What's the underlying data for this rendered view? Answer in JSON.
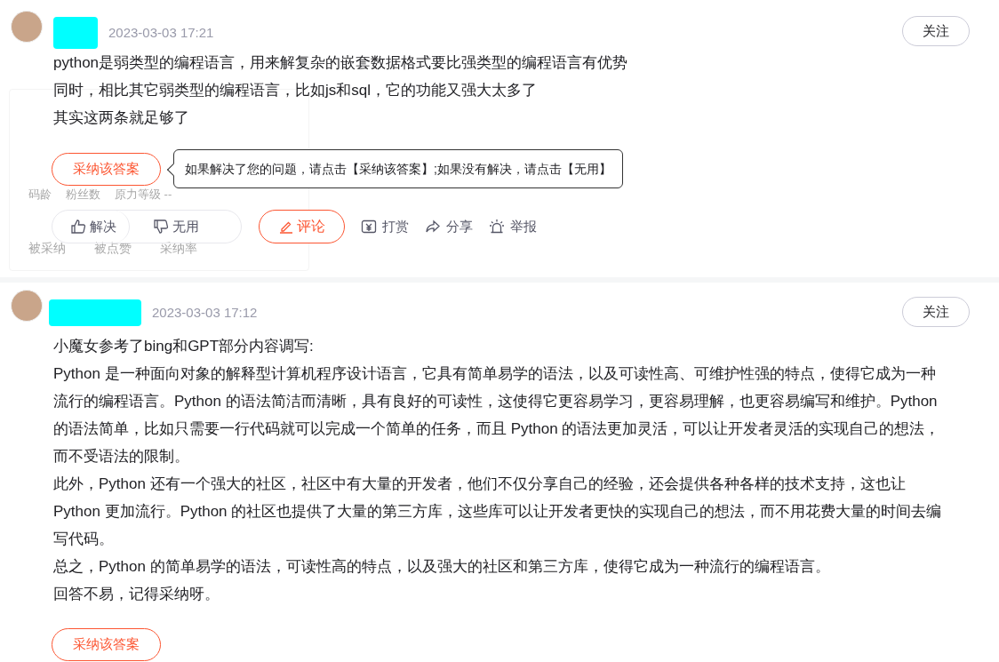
{
  "answers": [
    {
      "date": "2023-03-03 17:21",
      "follow": "关注",
      "paragraphs": [
        "python是弱类型的编程语言，用来解复杂的嵌套数据格式要比强类型的编程语言有优势",
        "同时，相比其它弱类型的编程语言，比如js和sql，它的功能又强大太多了",
        "其实这两条就足够了"
      ],
      "accept": "采纳该答案",
      "tooltip": "如果解决了您的问题，请点击【采纳该答案】;如果没有解决，请点击【无用】",
      "hover_card": {
        "row_1": [
          "码龄",
          "粉丝数",
          "原力等级 --"
        ],
        "row_2": [
          "被采纳",
          "被点赞",
          "采纳率"
        ]
      },
      "votes": [
        {
          "kind": "up",
          "label": "解决"
        },
        {
          "kind": "down",
          "label": "无用"
        }
      ],
      "comment": "评论",
      "actions": [
        {
          "kind": "reward",
          "label": "打赏"
        },
        {
          "kind": "share",
          "label": "分享"
        },
        {
          "kind": "report",
          "label": "举报"
        }
      ]
    },
    {
      "date": "2023-03-03 17:12",
      "follow": "关注",
      "paragraphs": [
        "小魔女参考了bing和GPT部分内容调写:",
        "Python 是一种面向对象的解释型计算机程序设计语言，它具有简单易学的语法，以及可读性高、可维护性强的特点，使得它成为一种流行的编程语言。Python 的语法简洁而清晰，具有良好的可读性，这使得它更容易学习，更容易理解，也更容易编写和维护。Python 的语法简单，比如只需要一行代码就可以完成一个简单的任务，而且 Python 的语法更加灵活，可以让开发者灵活的实现自己的想法，而不受语法的限制。",
        "此外，Python 还有一个强大的社区，社区中有大量的开发者，他们不仅分享自己的经验，还会提供各种各样的技术支持，这也让 Python 更加流行。Python 的社区也提供了大量的第三方库，这些库可以让开发者更快的实现自己的想法，而不用花费大量的时间去编写代码。",
        "总之，Python 的简单易学的语法，可读性高的特点，以及强大的社区和第三方库，使得它成为一种流行的编程语言。",
        "回答不易，记得采纳呀。"
      ],
      "accept": "采纳该答案"
    }
  ]
}
